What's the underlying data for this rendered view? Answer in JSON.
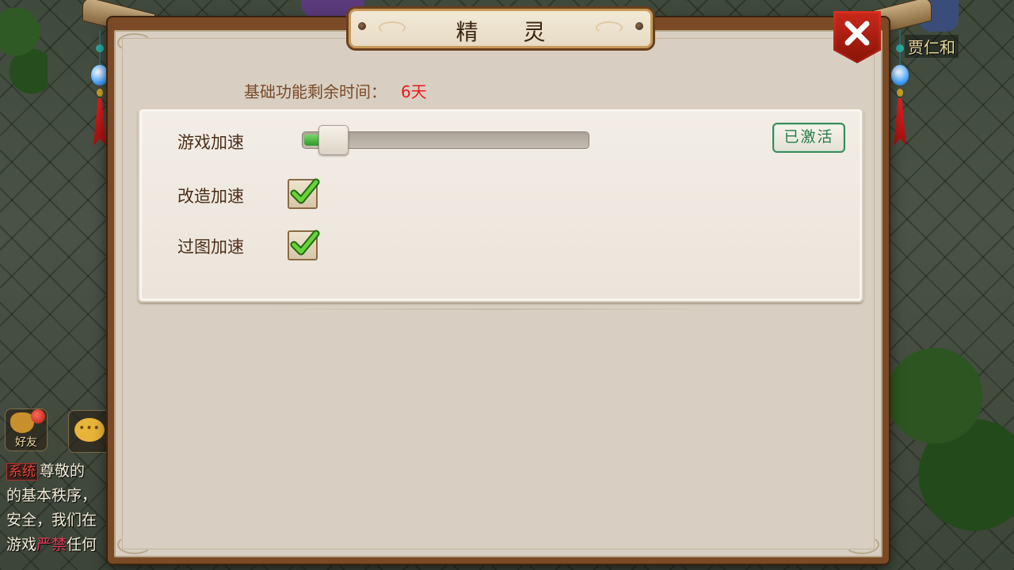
{
  "window": {
    "title": "精 灵",
    "close_icon": "close-x-icon"
  },
  "world": {
    "npc_name": "贾仁和"
  },
  "hud": {
    "friend_label": "好友",
    "chat_icon_text": "•••",
    "chat_lines": [
      {
        "tag": "系统",
        "text": "尊敬的"
      },
      {
        "text": "的基本秩序，"
      },
      {
        "text": "安全，我们在"
      },
      {
        "text": "游戏",
        "red": "严禁",
        "after": "任何"
      }
    ]
  },
  "status": {
    "time_label": "基础功能剩余时间：",
    "time_value": "6天"
  },
  "settings": {
    "speed": {
      "label": "游戏加速",
      "level": 0.07,
      "badge": "已激活"
    },
    "forge": {
      "label": "改造加速",
      "checked": true
    },
    "map": {
      "label": "过图加速",
      "checked": true
    }
  },
  "colors": {
    "accent_green": "#2a9a2a",
    "time_red": "#e81a1a",
    "frame_brown": "#7a4a26",
    "close_red": "#c82818"
  }
}
